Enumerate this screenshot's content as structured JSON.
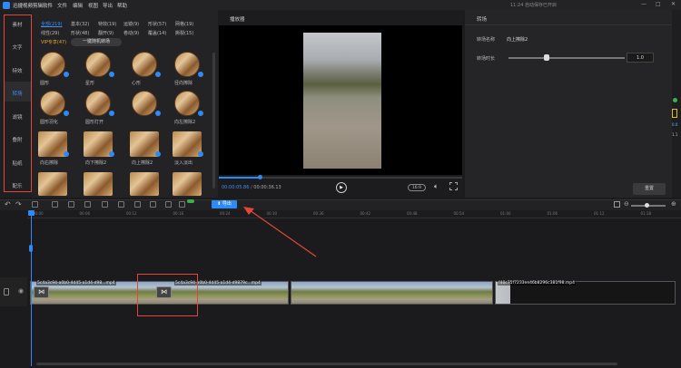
{
  "app": {
    "name": "迅捷视频剪辑软件",
    "menus": [
      "文件",
      "编辑",
      "视图",
      "导出",
      "帮助"
    ],
    "notice": "11:24 自动保存已开启",
    "window_controls": [
      "—",
      "□",
      "✕"
    ]
  },
  "rail": {
    "items": [
      "素材",
      "文字",
      "特效",
      "转场",
      "滤镜",
      "叠附",
      "贴纸",
      "配乐"
    ],
    "active": "转场"
  },
  "library": {
    "categories_row1": [
      "全部(219)",
      "基本(32)",
      "特效(19)",
      "运镜(9)",
      "形状(57)",
      "网格(19)"
    ],
    "categories_row2": [
      "线性(29)",
      "形状(48)",
      "翻开(9)",
      "卷动(9)",
      "覆盖(14)",
      "撕裂(15)"
    ],
    "vip": "VIP专享(47)",
    "one_click": "一键随机转场",
    "thumbs": [
      "圆形",
      "星形",
      "心形",
      "径向擦除",
      "圆形羽化",
      "圆形打开",
      "",
      "向左擦除2",
      "向右擦除",
      "向下擦除2",
      "向上擦除2",
      "淡入淡出",
      "",
      "",
      "",
      ""
    ]
  },
  "player": {
    "title": "播放器",
    "current_time": "00:00:05.86",
    "total_time": "00:00:36.13",
    "ratio": "16:9",
    "progress": 0.17
  },
  "properties": {
    "title": "转场",
    "name_label": "转场名称",
    "name_value": "向上擦除2",
    "duration_label": "转场时长",
    "duration_value": "1.0",
    "duration_fraction": 0.33,
    "reset": "重置"
  },
  "zoom_column": {
    "values": [
      "0.0",
      "1.1"
    ]
  },
  "toolbar": {
    "export": "导出"
  },
  "ruler": {
    "ticks": [
      "00:00",
      "00:06",
      "00:12",
      "00:18",
      "00:24",
      "00:30",
      "00:36",
      "00:42",
      "00:48",
      "00:54",
      "01:00",
      "01:06",
      "01:12",
      "01:18"
    ]
  },
  "timeline": {
    "clip1_label": "5c4a3c94-a0b0-4d45-a1d4-d98...mp4",
    "clip2_label": "5c4a3c94-a0b0-4d45-a1d4-d9879c...mp4",
    "clip3_label": "f40c75f7233ee46b8296c381f98.mp4"
  },
  "colors": {
    "accent": "#2e8af6",
    "annotation": "#e0463a"
  }
}
